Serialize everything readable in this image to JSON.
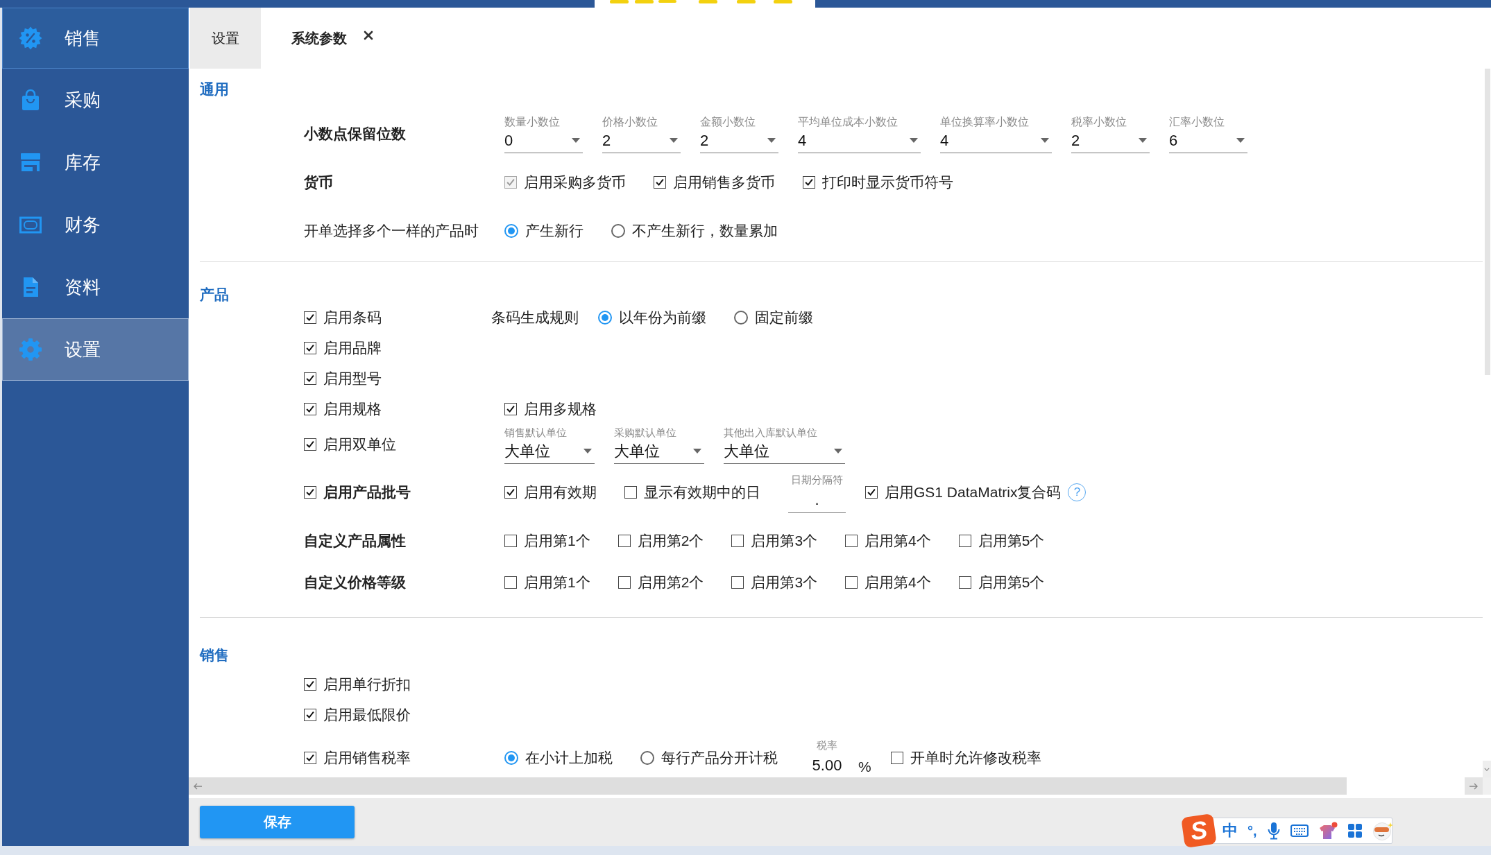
{
  "sidebar": {
    "items": [
      {
        "label": "销售",
        "kind": "header",
        "selected": false
      },
      {
        "label": "采购",
        "kind": "item",
        "selected": false
      },
      {
        "label": "库存",
        "kind": "item",
        "selected": false
      },
      {
        "label": "财务",
        "kind": "item",
        "selected": false
      },
      {
        "label": "资料",
        "kind": "item",
        "selected": false
      },
      {
        "label": "设置",
        "kind": "item",
        "selected": true
      }
    ]
  },
  "tabs": [
    {
      "label": "设置",
      "selected": false,
      "closable": false
    },
    {
      "label": "系统参数",
      "selected": true,
      "closable": true
    }
  ],
  "sections": [
    {
      "title": "通用",
      "rows": [
        {
          "kind": "label",
          "label": "小数点保留位数",
          "strong": true,
          "controls": [
            {
              "kind": "select",
              "caption": "数量小数位",
              "value": "0"
            },
            {
              "kind": "select",
              "caption": "价格小数位",
              "value": "2"
            },
            {
              "kind": "select",
              "caption": "金额小数位",
              "value": "2"
            },
            {
              "kind": "select",
              "caption": "平均单位成本小数位",
              "value": "4"
            },
            {
              "kind": "select",
              "caption": "单位换算率小数位",
              "value": "4"
            },
            {
              "kind": "select",
              "caption": "税率小数位",
              "value": "2"
            },
            {
              "kind": "select",
              "caption": "汇率小数位",
              "value": "6"
            }
          ]
        },
        {
          "kind": "label",
          "label": "货币",
          "strong": true,
          "controls": [
            {
              "kind": "check",
              "label": "启用采购多货币",
              "checked": true,
              "disabled": true
            },
            {
              "kind": "check",
              "label": "启用销售多货币",
              "checked": true,
              "disabled": false
            },
            {
              "kind": "check",
              "label": "打印时显示货币符号",
              "checked": true,
              "disabled": false
            }
          ]
        },
        {
          "kind": "label",
          "label": "开单选择多个一样的产品时",
          "strong": false,
          "controls": [
            {
              "kind": "radio",
              "label": "产生新行",
              "selected": true
            },
            {
              "kind": "radio",
              "label": "不产生新行，数量累加",
              "selected": false
            }
          ]
        }
      ]
    },
    {
      "title": "产品",
      "rows": [
        {
          "kind": "check",
          "label": "启用条码",
          "checked": true,
          "strong": false,
          "controls": [
            {
              "kind": "text",
              "text": "条码生成规则"
            },
            {
              "kind": "radio",
              "label": "以年份为前缀",
              "selected": true
            },
            {
              "kind": "radio",
              "label": "固定前缀",
              "selected": false
            }
          ]
        },
        {
          "kind": "check",
          "label": "启用品牌",
          "checked": true,
          "strong": false
        },
        {
          "kind": "check",
          "label": "启用型号",
          "checked": true,
          "strong": false
        },
        {
          "kind": "check",
          "label": "启用规格",
          "checked": true,
          "strong": false,
          "controls": [
            {
              "kind": "check",
              "label": "启用多规格",
              "checked": true,
              "disabled": false
            }
          ]
        },
        {
          "kind": "check",
          "label": "启用双单位",
          "checked": true,
          "strong": false,
          "controls": [
            {
              "kind": "select",
              "caption": "销售默认单位",
              "value": "大单位"
            },
            {
              "kind": "select",
              "caption": "采购默认单位",
              "value": "大单位"
            },
            {
              "kind": "select",
              "caption": "其他出入库默认单位",
              "value": "大单位"
            }
          ]
        },
        {
          "kind": "check",
          "label": "启用产品批号",
          "checked": true,
          "strong": true,
          "controls": [
            {
              "kind": "check",
              "label": "启用有效期",
              "checked": true,
              "disabled": false
            },
            {
              "kind": "check",
              "label": "显示有效期中的日",
              "checked": false,
              "disabled": false
            },
            {
              "kind": "field",
              "caption": "日期分隔符",
              "value": "."
            },
            {
              "kind": "check",
              "label": "启用GS1 DataMatrix复合码",
              "checked": true,
              "disabled": false
            },
            {
              "kind": "help",
              "text": "?"
            }
          ]
        },
        {
          "kind": "label",
          "label": "自定义产品属性",
          "strong": true,
          "controls": [
            {
              "kind": "check",
              "label": "启用第1个",
              "checked": false,
              "disabled": false
            },
            {
              "kind": "check",
              "label": "启用第2个",
              "checked": false,
              "disabled": false
            },
            {
              "kind": "check",
              "label": "启用第3个",
              "checked": false,
              "disabled": false
            },
            {
              "kind": "check",
              "label": "启用第4个",
              "checked": false,
              "disabled": false
            },
            {
              "kind": "check",
              "label": "启用第5个",
              "checked": false,
              "disabled": false
            }
          ]
        },
        {
          "kind": "label",
          "label": "自定义价格等级",
          "strong": true,
          "controls": [
            {
              "kind": "check",
              "label": "启用第1个",
              "checked": false,
              "disabled": false
            },
            {
              "kind": "check",
              "label": "启用第2个",
              "checked": false,
              "disabled": false
            },
            {
              "kind": "check",
              "label": "启用第3个",
              "checked": false,
              "disabled": false
            },
            {
              "kind": "check",
              "label": "启用第4个",
              "checked": false,
              "disabled": false
            },
            {
              "kind": "check",
              "label": "启用第5个",
              "checked": false,
              "disabled": false
            }
          ]
        }
      ]
    },
    {
      "title": "销售",
      "rows": [
        {
          "kind": "check",
          "label": "启用单行折扣",
          "checked": true,
          "strong": false
        },
        {
          "kind": "check",
          "label": "启用最低限价",
          "checked": true,
          "strong": false
        },
        {
          "kind": "check",
          "label": "启用销售税率",
          "checked": true,
          "strong": false,
          "controls": [
            {
              "kind": "radio",
              "label": "在小计上加税",
              "selected": true
            },
            {
              "kind": "radio",
              "label": "每行产品分开计税",
              "selected": false
            },
            {
              "kind": "field",
              "caption": "税率",
              "value": "5.00"
            },
            {
              "kind": "unit",
              "text": "%"
            },
            {
              "kind": "check",
              "label": "开单时允许修改税率",
              "checked": false,
              "disabled": false
            }
          ]
        }
      ]
    }
  ],
  "save_button": {
    "label": "保存"
  },
  "ime_toolbar": {
    "logo": "S",
    "mode": "中",
    "punctuation": "°,"
  }
}
